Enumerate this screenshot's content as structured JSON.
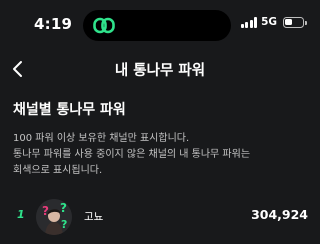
{
  "status_bar": {
    "time": "4:19",
    "network": "5G",
    "island_icon": "link-icon",
    "accent_color": "#2fe28b"
  },
  "nav": {
    "back_icon": "chevron-left-icon",
    "title": "내 통나무 파워"
  },
  "section": {
    "title": "채널별 통나무 파워",
    "description_lines": [
      "100 파워 이상 보유한 채널만 표시합니다.",
      "통나무 파워를 사용 중이지 않은 채널의 내 통나무 파워는",
      "회색으로 표시됩니다."
    ]
  },
  "ranking": [
    {
      "rank": "1",
      "avatar_icon": "avatar-question-marks-icon",
      "channel_name": "고뇨",
      "power": "304,924"
    }
  ]
}
